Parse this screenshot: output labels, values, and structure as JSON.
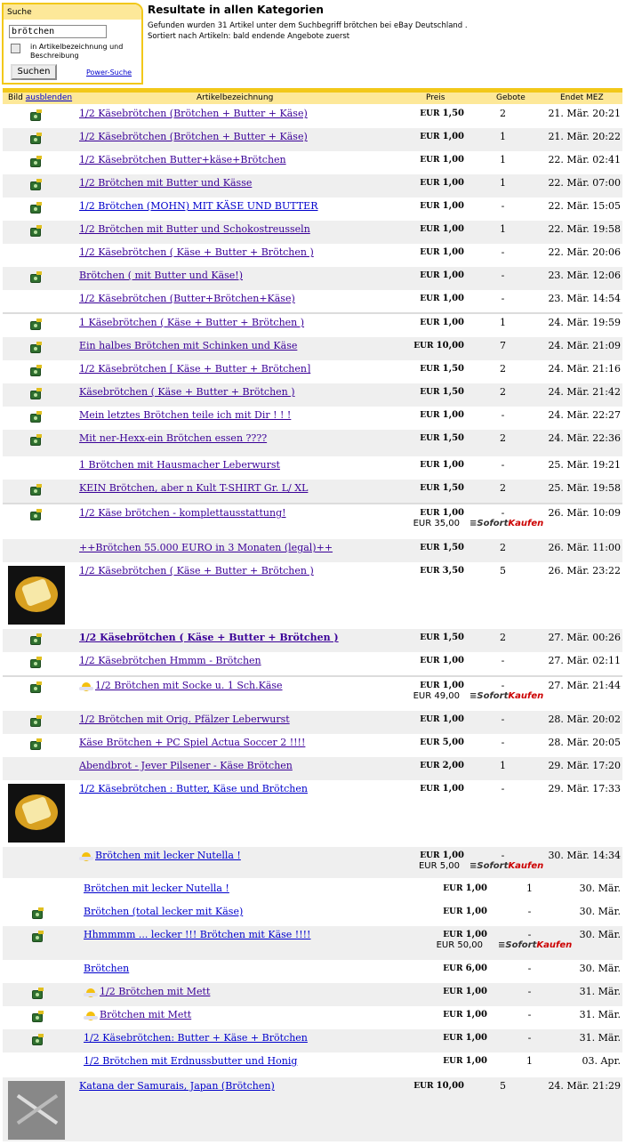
{
  "search": {
    "header": "Suche",
    "value": "brötchen",
    "checkbox_label": "in Artikelbezeichnung und Beschreibung",
    "button": "Suchen",
    "power_link": "Power-Suche"
  },
  "results": {
    "title": "Resultate in allen Kategorien",
    "line1": "Gefunden wurden 31 Artikel unter dem Suchbegriff brötchen bei eBay Deutschland .",
    "line2": "Sortiert nach Artikeln: bald endende Angebote zuerst"
  },
  "table": {
    "col_image": "Bild",
    "col_image_link": "ausblenden",
    "col_title": "Artikelbezeichnung",
    "col_price": "Preis",
    "col_bids": "Gebote",
    "col_ends": "Endet MEZ",
    "bin_label_1": "Sofort",
    "bin_label_2": "Kaufen",
    "rows": [
      {
        "title": "1/2 Käsebrötchen (Brötchen + Butter + Käse)",
        "cur": "EUR",
        "price": "1,50",
        "bids": "2",
        "ends": "21. Mär. 20:21"
      },
      {
        "title": "1/2 Käsebrötchen (Brötchen + Butter + Käse)",
        "cur": "EUR",
        "price": "1,00",
        "bids": "1",
        "ends": "21. Mär. 20:22"
      },
      {
        "title": "1/2 Käsebrötchen Butter+käse+Brötchen",
        "cur": "EUR",
        "price": "1,00",
        "bids": "1",
        "ends": "22. Mär. 02:41"
      },
      {
        "title": "1/2 Brötchen mit Butter und Kässe",
        "cur": "EUR",
        "price": "1,00",
        "bids": "1",
        "ends": "22. Mär. 07:00"
      },
      {
        "title": "1/2 Brötchen (MOHN) MIT KÄSE UND BUTTER",
        "cur": "EUR",
        "price": "1,00",
        "bids": "-",
        "ends": "22. Mär. 15:05"
      },
      {
        "title": "1/2 Brötchen mit Butter und Schokostreusseln",
        "cur": "EUR",
        "price": "1,00",
        "bids": "1",
        "ends": "22. Mär. 19:58"
      },
      {
        "title": "1/2 Käsebrötchen ( Käse + Butter + Brötchen )",
        "cur": "EUR",
        "price": "1,00",
        "bids": "-",
        "ends": "22. Mär. 20:06"
      },
      {
        "title": "Brötchen ( mit Butter und Käse!)",
        "cur": "EUR",
        "price": "1,00",
        "bids": "-",
        "ends": "23. Mär. 12:06"
      },
      {
        "title": "1/2 Käsebrötchen (Butter+Brötchen+Käse)",
        "cur": "EUR",
        "price": "1,00",
        "bids": "-",
        "ends": "23. Mär. 14:54"
      },
      {
        "title": "1 Käsebrötchen ( Käse + Butter + Brötchen )",
        "cur": "EUR",
        "price": "1,00",
        "bids": "1",
        "ends": "24. Mär. 19:59"
      },
      {
        "title": "Ein halbes Brötchen mit Schinken und Käse",
        "cur": "EUR",
        "price": "10,00",
        "bids": "7",
        "ends": "24. Mär. 21:09"
      },
      {
        "title": "1/2 Käsebrötchen [ Käse + Butter + Brötchen]",
        "cur": "EUR",
        "price": "1,50",
        "bids": "2",
        "ends": "24. Mär. 21:16"
      },
      {
        "title": "Käsebrötchen ( Käse + Butter + Brötchen )",
        "cur": "EUR",
        "price": "1,50",
        "bids": "2",
        "ends": "24. Mär. 21:42"
      },
      {
        "title": "Mein letztes Brötchen teile ich mit Dir ! ! !",
        "cur": "EUR",
        "price": "1,00",
        "bids": "-",
        "ends": "24. Mär. 22:27"
      },
      {
        "title": "Mit ner-Hexx-ein Brötchen essen ????",
        "cur": "EUR",
        "price": "1,50",
        "bids": "2",
        "ends": "24. Mär. 22:36"
      },
      {
        "title": "1 Brötchen mit Hausmacher Leberwurst",
        "cur": "EUR",
        "price": "1,00",
        "bids": "-",
        "ends": "25. Mär. 19:21"
      },
      {
        "title": "KEIN Brötchen, aber n Kult T-SHIRT Gr. L/ XL",
        "cur": "EUR",
        "price": "1,50",
        "bids": "2",
        "ends": "25. Mär. 19:58"
      },
      {
        "title": "1/2 Käse brötchen - komplettausstattung!",
        "cur": "EUR",
        "price": "1,00",
        "bin_cur": "EUR",
        "bin_price": "35,00",
        "bids": "-",
        "ends": "26. Mär. 10:09"
      },
      {
        "title": "++Brötchen 55.000 EURO in 3 Monaten (legal)++",
        "cur": "EUR",
        "price": "1,50",
        "bids": "2",
        "ends": "26. Mär. 11:00"
      },
      {
        "title": "1/2 Käsebrötchen ( Käse + Butter + Brötchen )",
        "cur": "EUR",
        "price": "3,50",
        "bids": "5",
        "ends": "26. Mär. 23:22"
      },
      {
        "title": "1/2 Käsebrötchen ( Käse + Butter + Brötchen )",
        "cur": "EUR",
        "price": "1,50",
        "bids": "2",
        "ends": "27. Mär. 00:26"
      },
      {
        "title": "1/2 Käsebrötchen Hmmm - Brötchen",
        "cur": "EUR",
        "price": "1,00",
        "bids": "-",
        "ends": "27. Mär. 02:11"
      },
      {
        "title": "1/2 Brötchen mit Socke u. 1 Sch.Käse",
        "cur": "EUR",
        "price": "1,00",
        "bin_cur": "EUR",
        "bin_price": "49,00",
        "bids": "-",
        "ends": "27. Mär. 21:44"
      },
      {
        "title": "1/2 Brötchen mit Orig. Pfälzer Leberwurst",
        "cur": "EUR",
        "price": "1,00",
        "bids": "-",
        "ends": "28. Mär. 20:02"
      },
      {
        "title": "Käse Brötchen + PC Spiel Actua Soccer 2 !!!!",
        "cur": "EUR",
        "price": "5,00",
        "bids": "-",
        "ends": "28. Mär. 20:05"
      },
      {
        "title": "Abendbrot - Jever Pilsener - Käse Brötchen",
        "cur": "EUR",
        "price": "2,00",
        "bids": "1",
        "ends": "29. Mär. 17:20"
      },
      {
        "title": "1/2 Käsebrötchen : Butter, Käse und Brötchen",
        "cur": "EUR",
        "price": "1,00",
        "bids": "-",
        "ends": "29. Mär. 17:33"
      },
      {
        "title": "Brötchen mit lecker Nutella !",
        "cur": "EUR",
        "price": "1,00",
        "bin_cur": "EUR",
        "bin_price": "5,00",
        "bids": "-",
        "ends": "30. Mär. 14:34"
      },
      {
        "title": "Brötchen mit lecker Nutella !",
        "cur": "EUR",
        "price": "1,00",
        "bids": "1",
        "ends": "30. Mär."
      },
      {
        "title": "Brötchen (total lecker mit Käse)",
        "cur": "EUR",
        "price": "1,00",
        "bids": "-",
        "ends": "30. Mär."
      },
      {
        "title": "Hhmmmm ... lecker !!! Brötchen mit Käse !!!!",
        "cur": "EUR",
        "price": "1,00",
        "bin_cur": "EUR",
        "bin_price": "50,00",
        "bids": "-",
        "ends": "30. Mär."
      },
      {
        "title": "Brötchen",
        "cur": "EUR",
        "price": "6,00",
        "bids": "-",
        "ends": "30. Mär."
      },
      {
        "title": "1/2 Brötchen mit Mett",
        "cur": "EUR",
        "price": "1,00",
        "bids": "-",
        "ends": "31. Mär."
      },
      {
        "title": "Brötchen mit Mett",
        "cur": "EUR",
        "price": "1,00",
        "bids": "-",
        "ends": "31. Mär."
      },
      {
        "title": "1/2 Käsebrötchen: Butter + Käse + Brötchen",
        "cur": "EUR",
        "price": "1,00",
        "bids": "-",
        "ends": "31. Mär."
      },
      {
        "title": "1/2 Brötchen mit Erdnussbutter und Honig",
        "cur": "EUR",
        "price": "1,00",
        "bids": "1",
        "ends": "03. Apr."
      },
      {
        "title": "Katana der Samurais, Japan (Brötchen)",
        "cur": "EUR",
        "price": "10,00",
        "bids": "5",
        "ends": "24. Mär. 21:29"
      }
    ]
  }
}
